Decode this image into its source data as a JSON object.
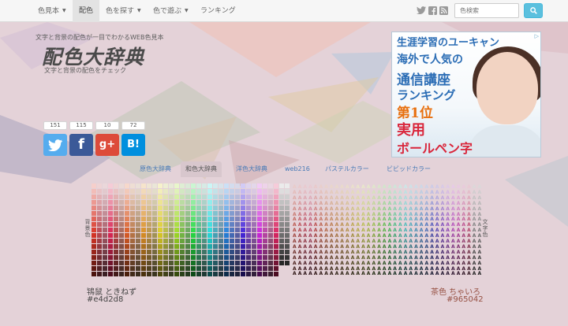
{
  "nav": {
    "items": [
      {
        "label": "色見本",
        "caret": "▼"
      },
      {
        "label": "配色",
        "caret": ""
      },
      {
        "label": "色を探す",
        "caret": "▼"
      },
      {
        "label": "色で遊ぶ",
        "caret": "▼"
      },
      {
        "label": "ランキング",
        "caret": ""
      }
    ],
    "social": [
      "twitter-icon",
      "facebook-icon",
      "rss-icon"
    ],
    "search_placeholder": "色検索",
    "search_icon": "search-icon"
  },
  "header": {
    "tagline": "文字と背景の配色が一目でわかるWEB色見本",
    "logo": "配色大辞典",
    "subtitle": "文字と背景の配色をチェック"
  },
  "ad": {
    "line1": "生涯学習のユーキャン",
    "line2": "海外で人気の",
    "line3": "通信講座",
    "line4": "ランキング",
    "line5": "第1位",
    "line6": "実用",
    "line7": "ボールペン字",
    "colors": {
      "blue": "#2b6db5",
      "red": "#d9263b",
      "orange": "#e8700f"
    }
  },
  "share": {
    "counts": [
      "151",
      "115",
      "10",
      "72"
    ],
    "buttons": [
      {
        "icon": "twitter-icon",
        "color": "#55acee",
        "glyph": "t"
      },
      {
        "icon": "facebook-icon",
        "color": "#3b5998",
        "glyph": "f"
      },
      {
        "icon": "google-plus-icon",
        "color": "#dd4b39",
        "glyph": "g+"
      },
      {
        "icon": "hatena-bookmark-icon",
        "color": "#008fde",
        "glyph": "B!"
      }
    ]
  },
  "tabs": [
    {
      "label": "原色大辞典",
      "active": false
    },
    {
      "label": "和色大辞典",
      "active": true
    },
    {
      "label": "洋色大辞典",
      "active": false
    },
    {
      "label": "web216",
      "active": false
    },
    {
      "label": "パステルカラー",
      "active": false
    },
    {
      "label": "ビビッドカラー",
      "active": false
    }
  ],
  "palette": {
    "bg_label": "背景色",
    "text_label": "文字色",
    "glyph": "A",
    "background": {
      "name": "鴇鼠 ときねず",
      "hex": "#e4d2d8"
    },
    "text": {
      "name": "茶色 ちゃいろ",
      "hex": "#965042"
    }
  }
}
